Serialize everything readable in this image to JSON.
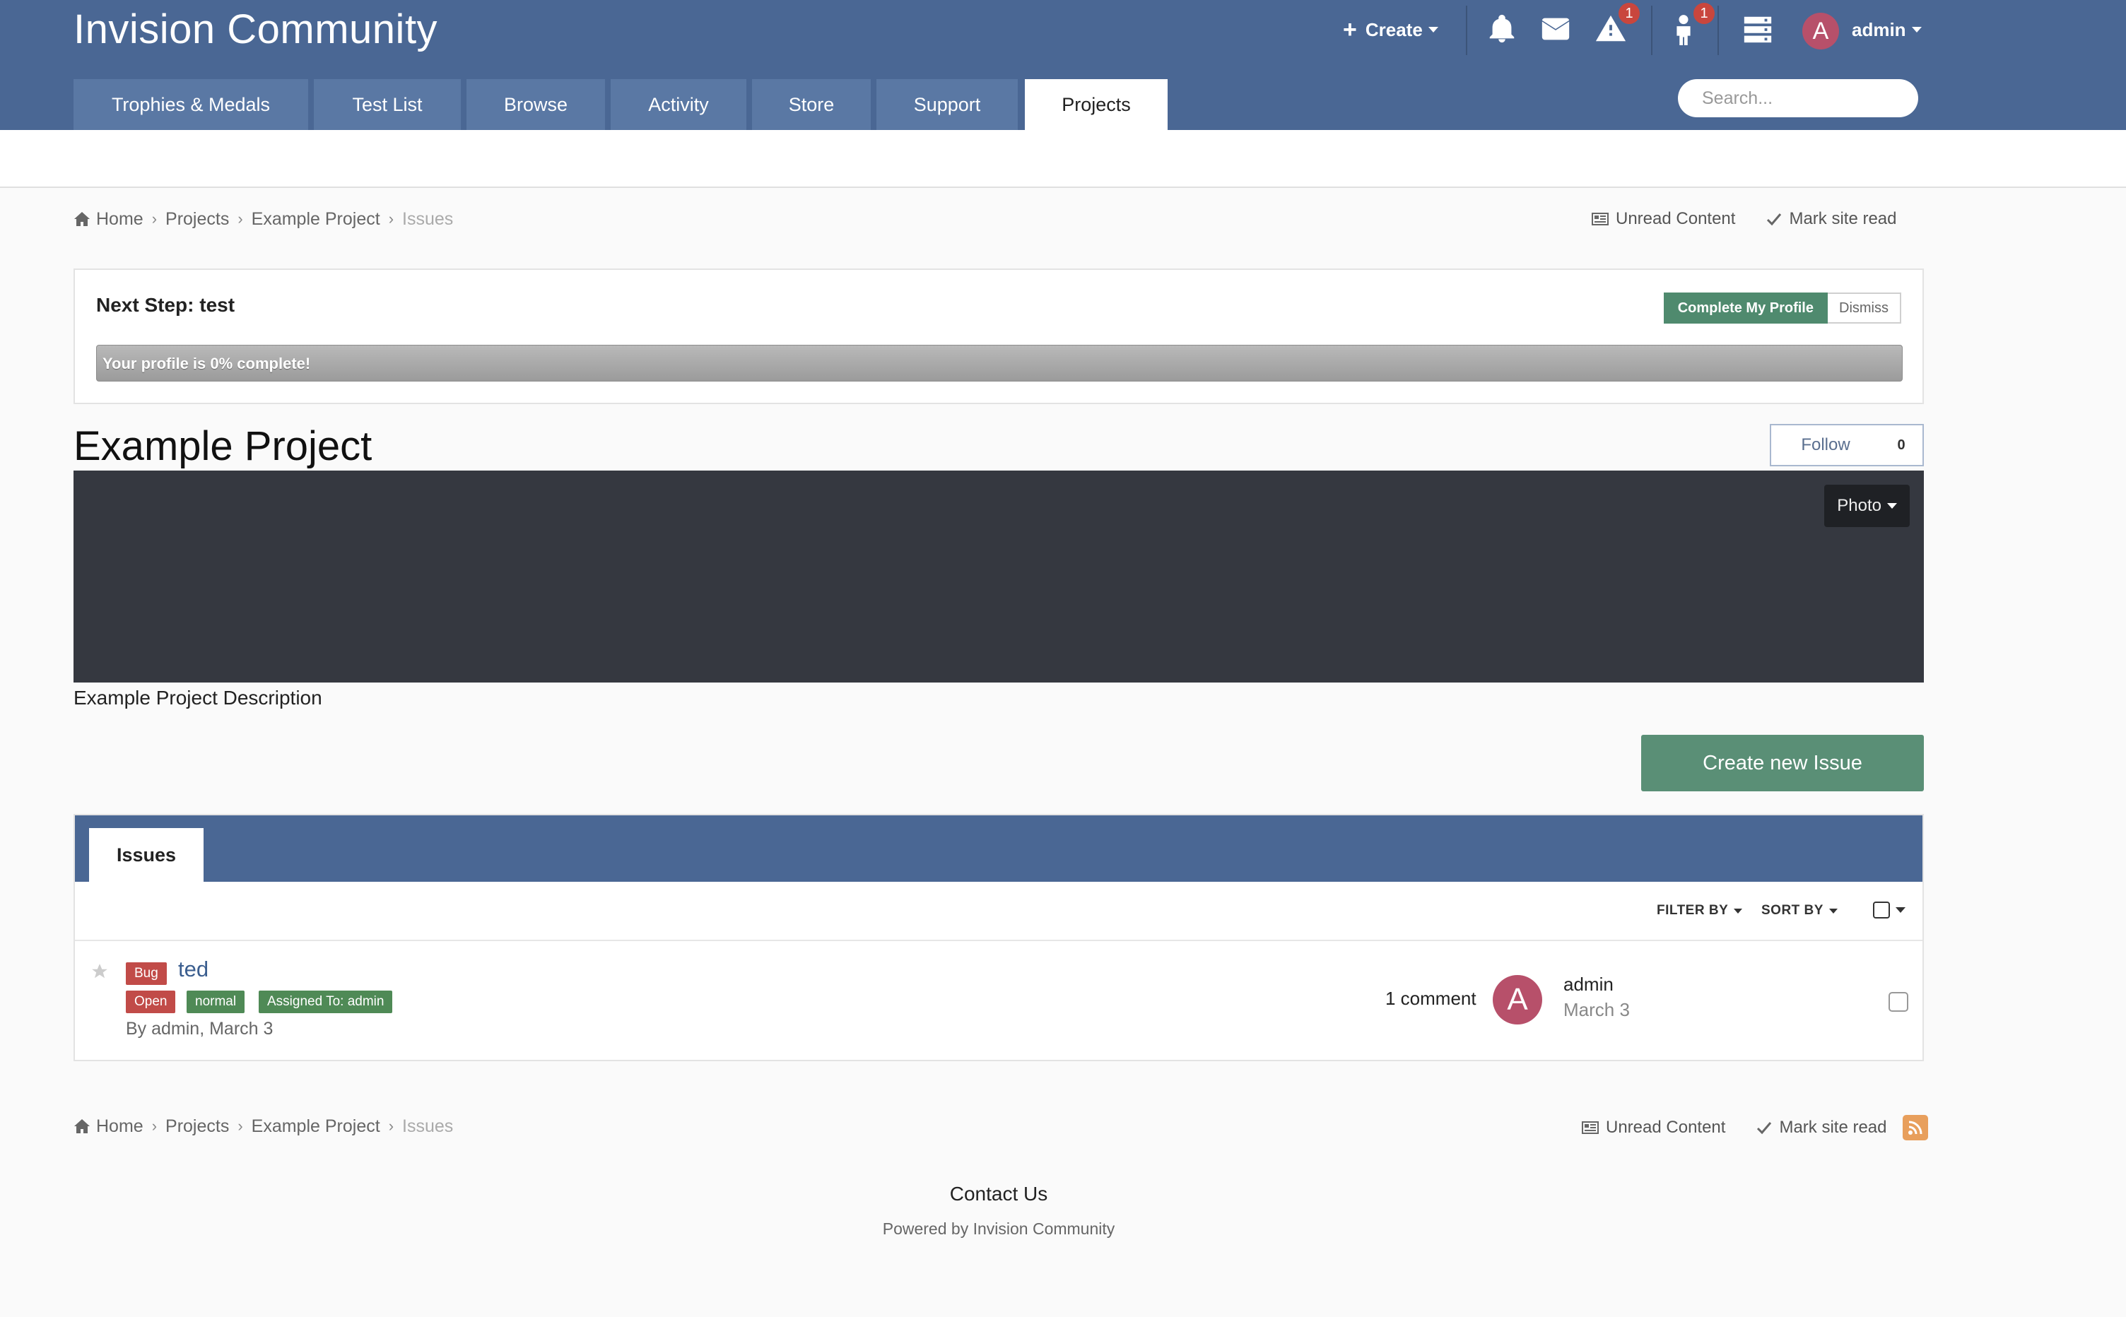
{
  "header": {
    "site_title": "Invision Community",
    "create_label": "Create",
    "notifications_icon": "bell-icon",
    "messages_icon": "envelope-icon",
    "reports_badge": "1",
    "warnings_badge": "1",
    "user_initial": "A",
    "user_name": "admin",
    "accent_color": "#4a6794"
  },
  "nav": {
    "tabs": [
      {
        "label": "Trophies & Medals"
      },
      {
        "label": "Test List"
      },
      {
        "label": "Browse"
      },
      {
        "label": "Activity"
      },
      {
        "label": "Store"
      },
      {
        "label": "Support"
      },
      {
        "label": "Projects"
      }
    ],
    "active_tab": "Projects"
  },
  "search": {
    "placeholder": "Search..."
  },
  "breadcrumb": {
    "items": [
      "Home",
      "Projects",
      "Example Project",
      "Issues"
    ]
  },
  "utility": {
    "unread_content": "Unread Content",
    "mark_site_read": "Mark site read"
  },
  "profile_step": {
    "next_step": "Next Step: test",
    "complete_label": "Complete My Profile",
    "dismiss_label": "Dismiss",
    "progress_text": "Your profile is 0% complete!",
    "progress_percent": 0
  },
  "project": {
    "title": "Example Project",
    "follow_label": "Follow",
    "follow_count": "0",
    "photo_label": "Photo",
    "description": "Example Project Description",
    "create_issue_label": "Create new Issue"
  },
  "issues": {
    "tab_label": "Issues",
    "filter_label": "FILTER BY",
    "sort_label": "SORT BY",
    "rows": [
      {
        "type_tag": "Bug",
        "title": "ted",
        "tags": [
          "Open",
          "normal",
          "Assigned To: admin"
        ],
        "meta": "By admin, March 3",
        "comments": "1 comment",
        "last_author_initial": "A",
        "last_author": "admin",
        "last_date": "March 3"
      }
    ]
  },
  "footer": {
    "contact": "Contact Us",
    "powered_by": "Powered by Invision Community"
  }
}
